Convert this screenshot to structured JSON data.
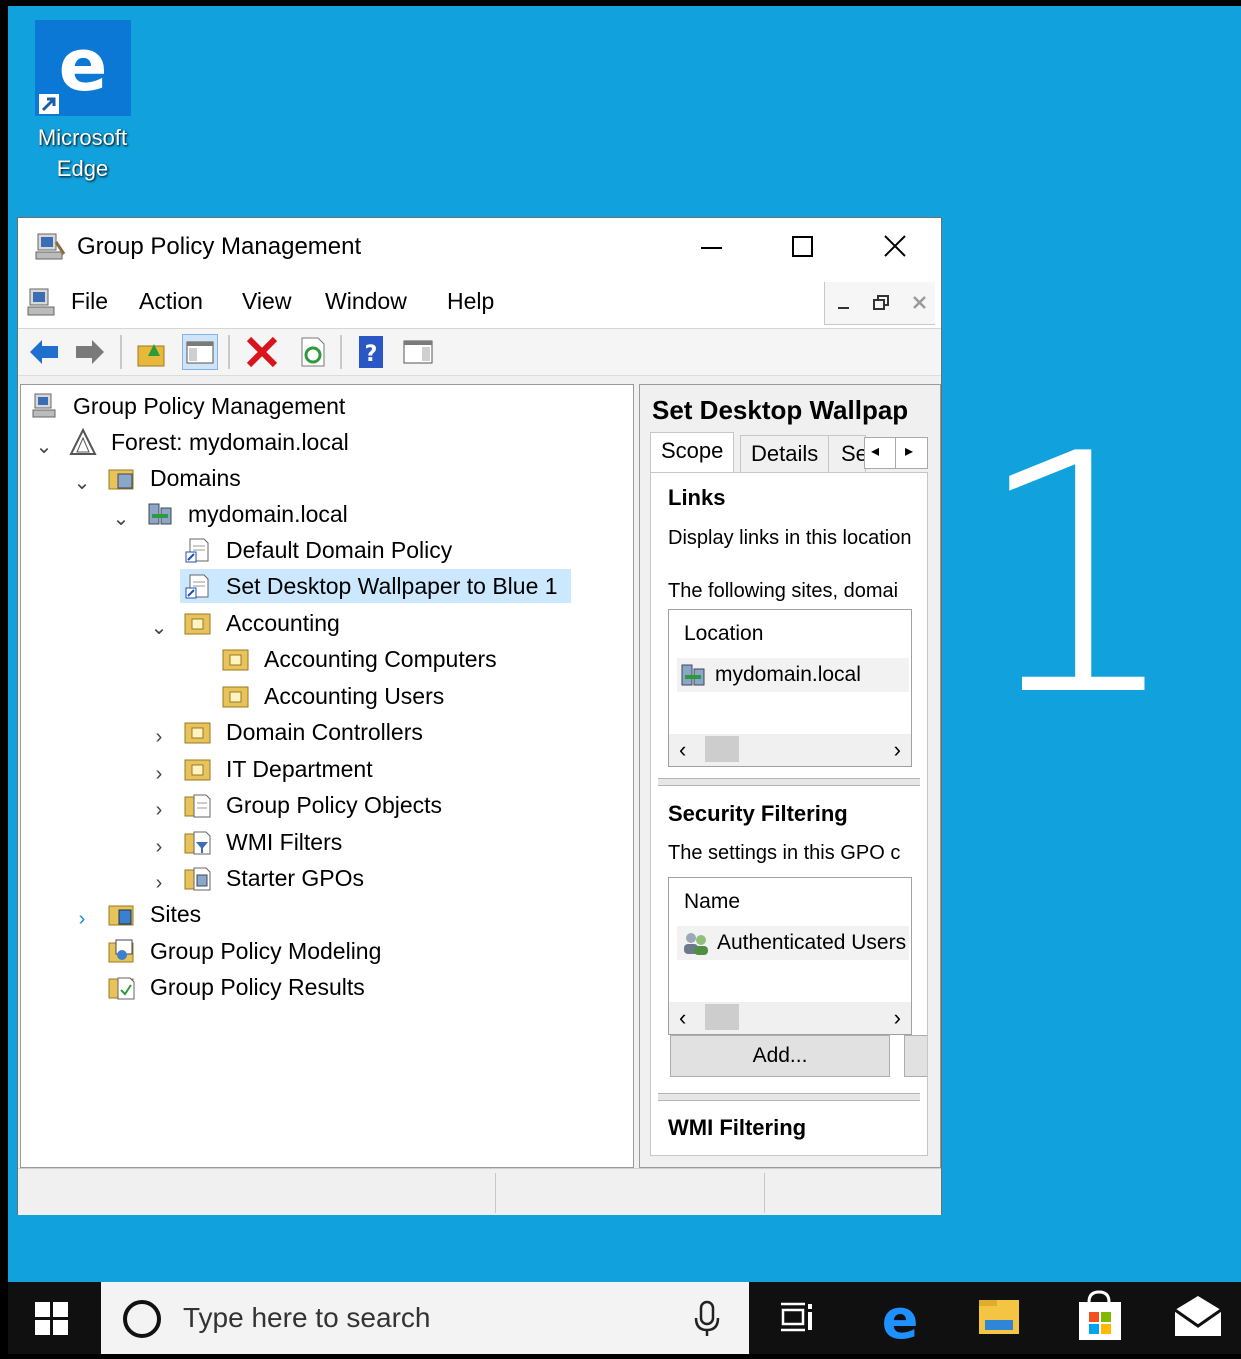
{
  "desktop": {
    "edge_label_line1": "Microsoft",
    "edge_label_line2": "Edge",
    "watermark": "1",
    "background_color": "#11a1dc"
  },
  "window": {
    "title": "Group Policy Management",
    "menu": [
      "File",
      "Action",
      "View",
      "Window",
      "Help"
    ],
    "toolbar_icons": [
      "back-arrow-icon",
      "forward-arrow-icon",
      "up-folder-icon",
      "show-hide-console-tree-icon",
      "delete-icon",
      "refresh-icon",
      "help-icon",
      "show-action-pane-icon"
    ]
  },
  "tree": {
    "root": "Group Policy Management",
    "forest": "Forest: mydomain.local",
    "domains": "Domains",
    "domain": "mydomain.local",
    "gpo1": "Default Domain Policy",
    "gpo2": "Set Desktop Wallpaper to Blue 1",
    "ou_accounting": "Accounting",
    "ou_acc_computers": "Accounting Computers",
    "ou_acc_users": "Accounting Users",
    "ou_dc": "Domain Controllers",
    "ou_it": "IT Department",
    "gpo_container": "Group Policy Objects",
    "wmi": "WMI Filters",
    "starter": "Starter GPOs",
    "sites": "Sites",
    "modeling": "Group Policy Modeling",
    "results": "Group Policy Results"
  },
  "details": {
    "heading": "Set Desktop Wallpap",
    "tabs": [
      "Scope",
      "Details",
      "Se"
    ],
    "links_title": "Links",
    "links_display": "Display links in this location",
    "links_following": "The following sites, domai",
    "location_header": "Location",
    "location_row": "mydomain.local",
    "security_title": "Security Filtering",
    "security_text": "The settings in this GPO c",
    "name_header": "Name",
    "name_row": "Authenticated Users",
    "add_button": "Add...",
    "wmi_title": "WMI Filtering"
  },
  "taskbar": {
    "search_placeholder": "Type here to search",
    "icons": [
      "windows-start-icon",
      "cortana-circle-icon",
      "microphone-icon",
      "task-view-icon",
      "edge-icon",
      "file-explorer-icon",
      "store-icon",
      "mail-icon"
    ]
  }
}
